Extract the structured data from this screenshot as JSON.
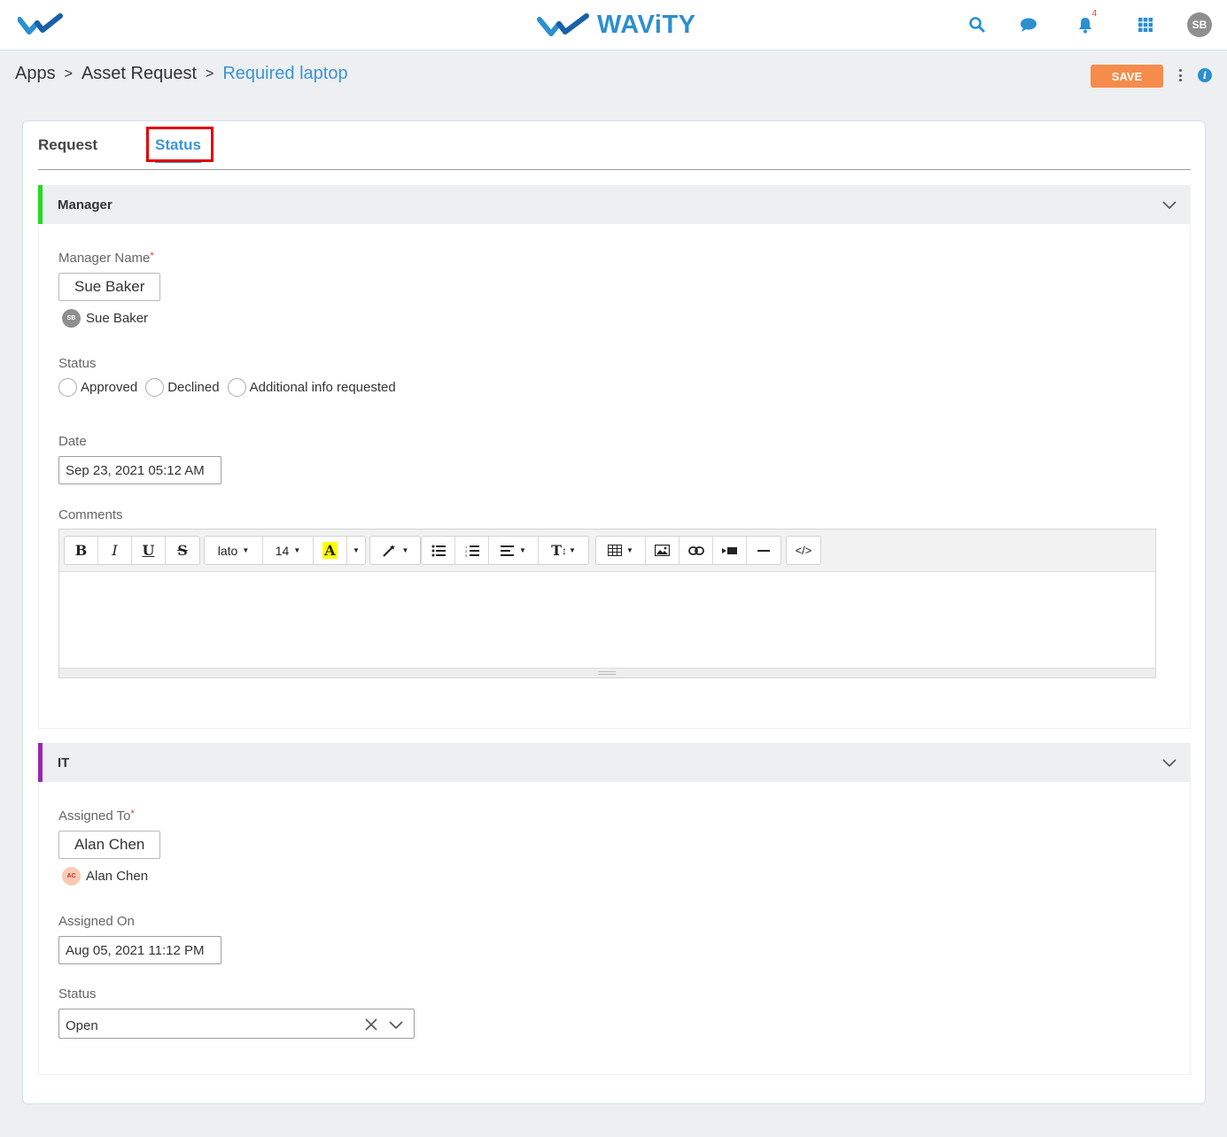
{
  "header": {
    "brand": "WAViTY",
    "notification_count": "4",
    "user_initials": "SB",
    "accent_color": "#2b8fd0"
  },
  "breadcrumb": {
    "items": [
      "Apps",
      "Asset Request"
    ],
    "separator": ">",
    "current": "Required laptop"
  },
  "toolbar": {
    "save_label": "SAVE"
  },
  "tabs": {
    "request": "Request",
    "status": "Status",
    "active": "Status"
  },
  "manager_section": {
    "title": "Manager",
    "bar_color": "#22dd22",
    "manager_name_label": "Manager Name",
    "required_mark": "*",
    "manager_name_value": "Sue Baker",
    "manager_user": {
      "initials": "SB",
      "name": "Sue Baker"
    },
    "status_label": "Status",
    "status_options": [
      "Approved",
      "Declined",
      "Additional info requested"
    ],
    "date_label": "Date",
    "date_value": "Sep 23, 2021 05:12 AM",
    "comments_label": "Comments",
    "editor": {
      "font_name": "lato",
      "font_size": "14",
      "highlight_letter": "A"
    }
  },
  "it_section": {
    "title": "IT",
    "bar_color": "#9c27b0",
    "assigned_to_label": "Assigned To",
    "required_mark": "*",
    "assigned_to_value": "Alan Chen",
    "assigned_user": {
      "initials": "AC",
      "name": "Alan Chen"
    },
    "assigned_on_label": "Assigned On",
    "assigned_on_value": "Aug 05, 2021 11:12 PM",
    "status_label": "Status",
    "status_value": "Open"
  }
}
